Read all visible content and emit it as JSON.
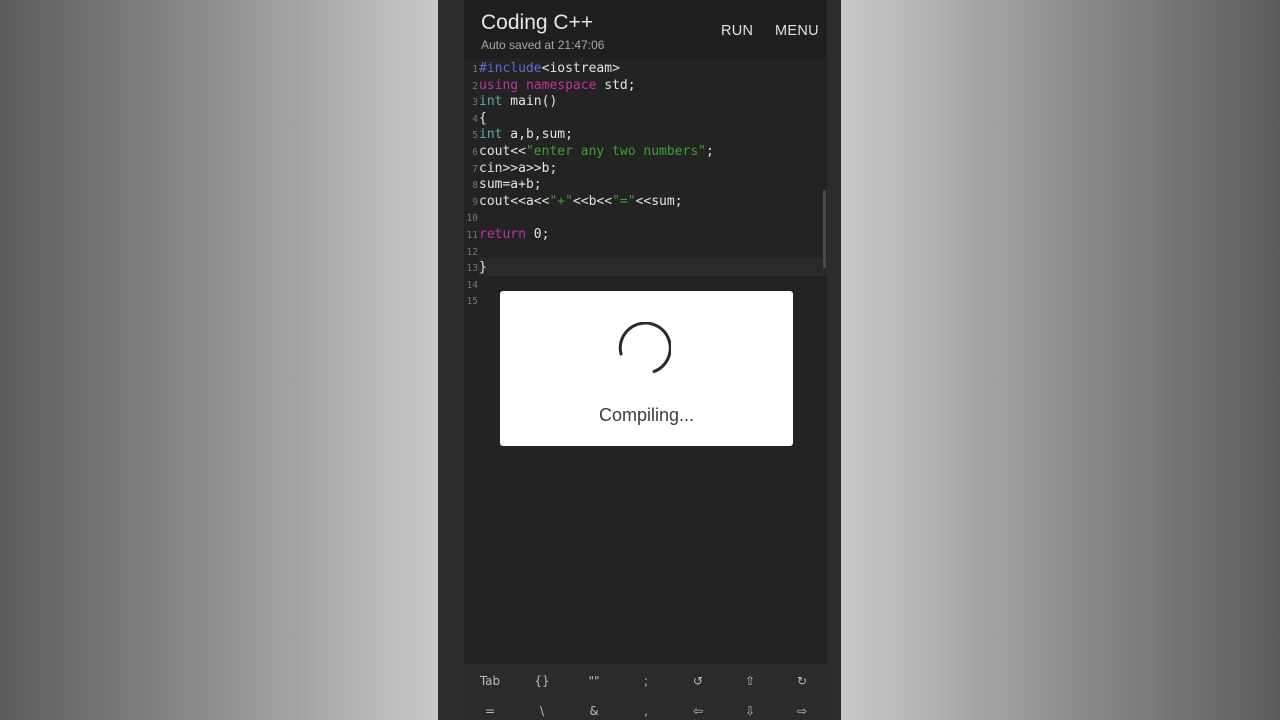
{
  "app": {
    "title": "Coding C++",
    "autosave": "Auto saved at 21:47:06",
    "run_label": "RUN",
    "menu_label": "MENU"
  },
  "editor": {
    "line_numbers": [
      "1",
      "2",
      "3",
      "4",
      "5",
      "6",
      "7",
      "8",
      "9",
      "10",
      "11",
      "12",
      "13",
      "14",
      "15"
    ],
    "lines": [
      [
        {
          "t": "#include",
          "c": "kw-blue"
        },
        {
          "t": "<iostream>",
          "c": ""
        }
      ],
      [
        {
          "t": "using",
          "c": "kw-pink"
        },
        {
          "t": " ",
          "c": ""
        },
        {
          "t": "namespace",
          "c": "kw-pink"
        },
        {
          "t": " std;",
          "c": ""
        }
      ],
      [
        {
          "t": "int",
          "c": "kw-teal"
        },
        {
          "t": " main()",
          "c": ""
        }
      ],
      [
        {
          "t": "{",
          "c": ""
        }
      ],
      [
        {
          "t": "int",
          "c": "kw-teal"
        },
        {
          "t": " a,b,sum;",
          "c": ""
        }
      ],
      [
        {
          "t": "cout<<",
          "c": ""
        },
        {
          "t": "\"enter any two numbers\"",
          "c": "str"
        },
        {
          "t": ";",
          "c": ""
        }
      ],
      [
        {
          "t": "cin>>a>>b;",
          "c": ""
        }
      ],
      [
        {
          "t": "sum=a+b;",
          "c": ""
        }
      ],
      [
        {
          "t": "cout<<a<<",
          "c": ""
        },
        {
          "t": "\"+\"",
          "c": "str"
        },
        {
          "t": "<<b<<",
          "c": ""
        },
        {
          "t": "\"=\"",
          "c": "str"
        },
        {
          "t": "<<sum;",
          "c": ""
        }
      ],
      [],
      [
        {
          "t": "return",
          "c": "kw-pink"
        },
        {
          "t": " 0;",
          "c": ""
        }
      ],
      [],
      [
        {
          "t": "}",
          "c": ""
        }
      ],
      [],
      []
    ]
  },
  "dialog": {
    "message": "Compiling..."
  },
  "keyboard": {
    "row1": [
      {
        "label": "Tab",
        "name": "key-tab"
      },
      {
        "label": "{}",
        "name": "key-braces"
      },
      {
        "label": "\"\"",
        "name": "key-quotes"
      },
      {
        "label": ";",
        "name": "key-semicolon"
      },
      {
        "label": "↺",
        "name": "undo-icon"
      },
      {
        "label": "⇧",
        "name": "shift-icon"
      },
      {
        "label": "↻",
        "name": "redo-icon"
      }
    ],
    "row2": [
      {
        "label": "=",
        "name": "key-equals"
      },
      {
        "label": "\\",
        "name": "key-backslash"
      },
      {
        "label": "&",
        "name": "key-ampersand"
      },
      {
        "label": ",",
        "name": "key-comma"
      },
      {
        "label": "⇦",
        "name": "arrow-left-icon"
      },
      {
        "label": "⇩",
        "name": "arrow-down-icon"
      },
      {
        "label": "⇨",
        "name": "arrow-right-icon"
      }
    ]
  },
  "colors": {
    "keyword_blue": "#5a6fd6",
    "keyword_pink": "#c0349b",
    "type_teal": "#5fa8a0",
    "string_green": "#3f9e36"
  }
}
